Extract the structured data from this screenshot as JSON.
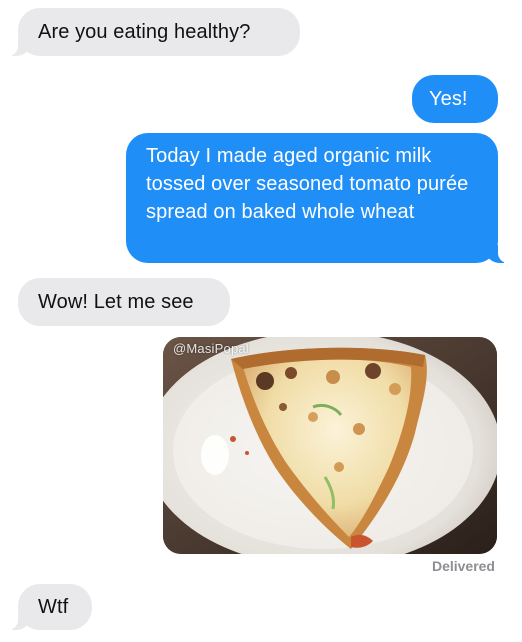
{
  "conversation": {
    "messages": [
      {
        "direction": "received",
        "text": "Are you eating healthy?"
      },
      {
        "direction": "sent",
        "text": "Yes!"
      },
      {
        "direction": "sent",
        "text": "Today I made aged organic milk tossed over seasoned tomato purée spread on baked whole wheat"
      },
      {
        "direction": "received",
        "text": "Wow! Let me see"
      },
      {
        "direction": "received",
        "text": "Wtf"
      }
    ],
    "photo": {
      "watermark": "@MasiPopal",
      "subject": "slice of cheese pizza on a white plate"
    },
    "status": "Delivered"
  },
  "colors": {
    "sent_bubble": "#1f8ef7",
    "received_bubble": "#e9e9eb"
  }
}
